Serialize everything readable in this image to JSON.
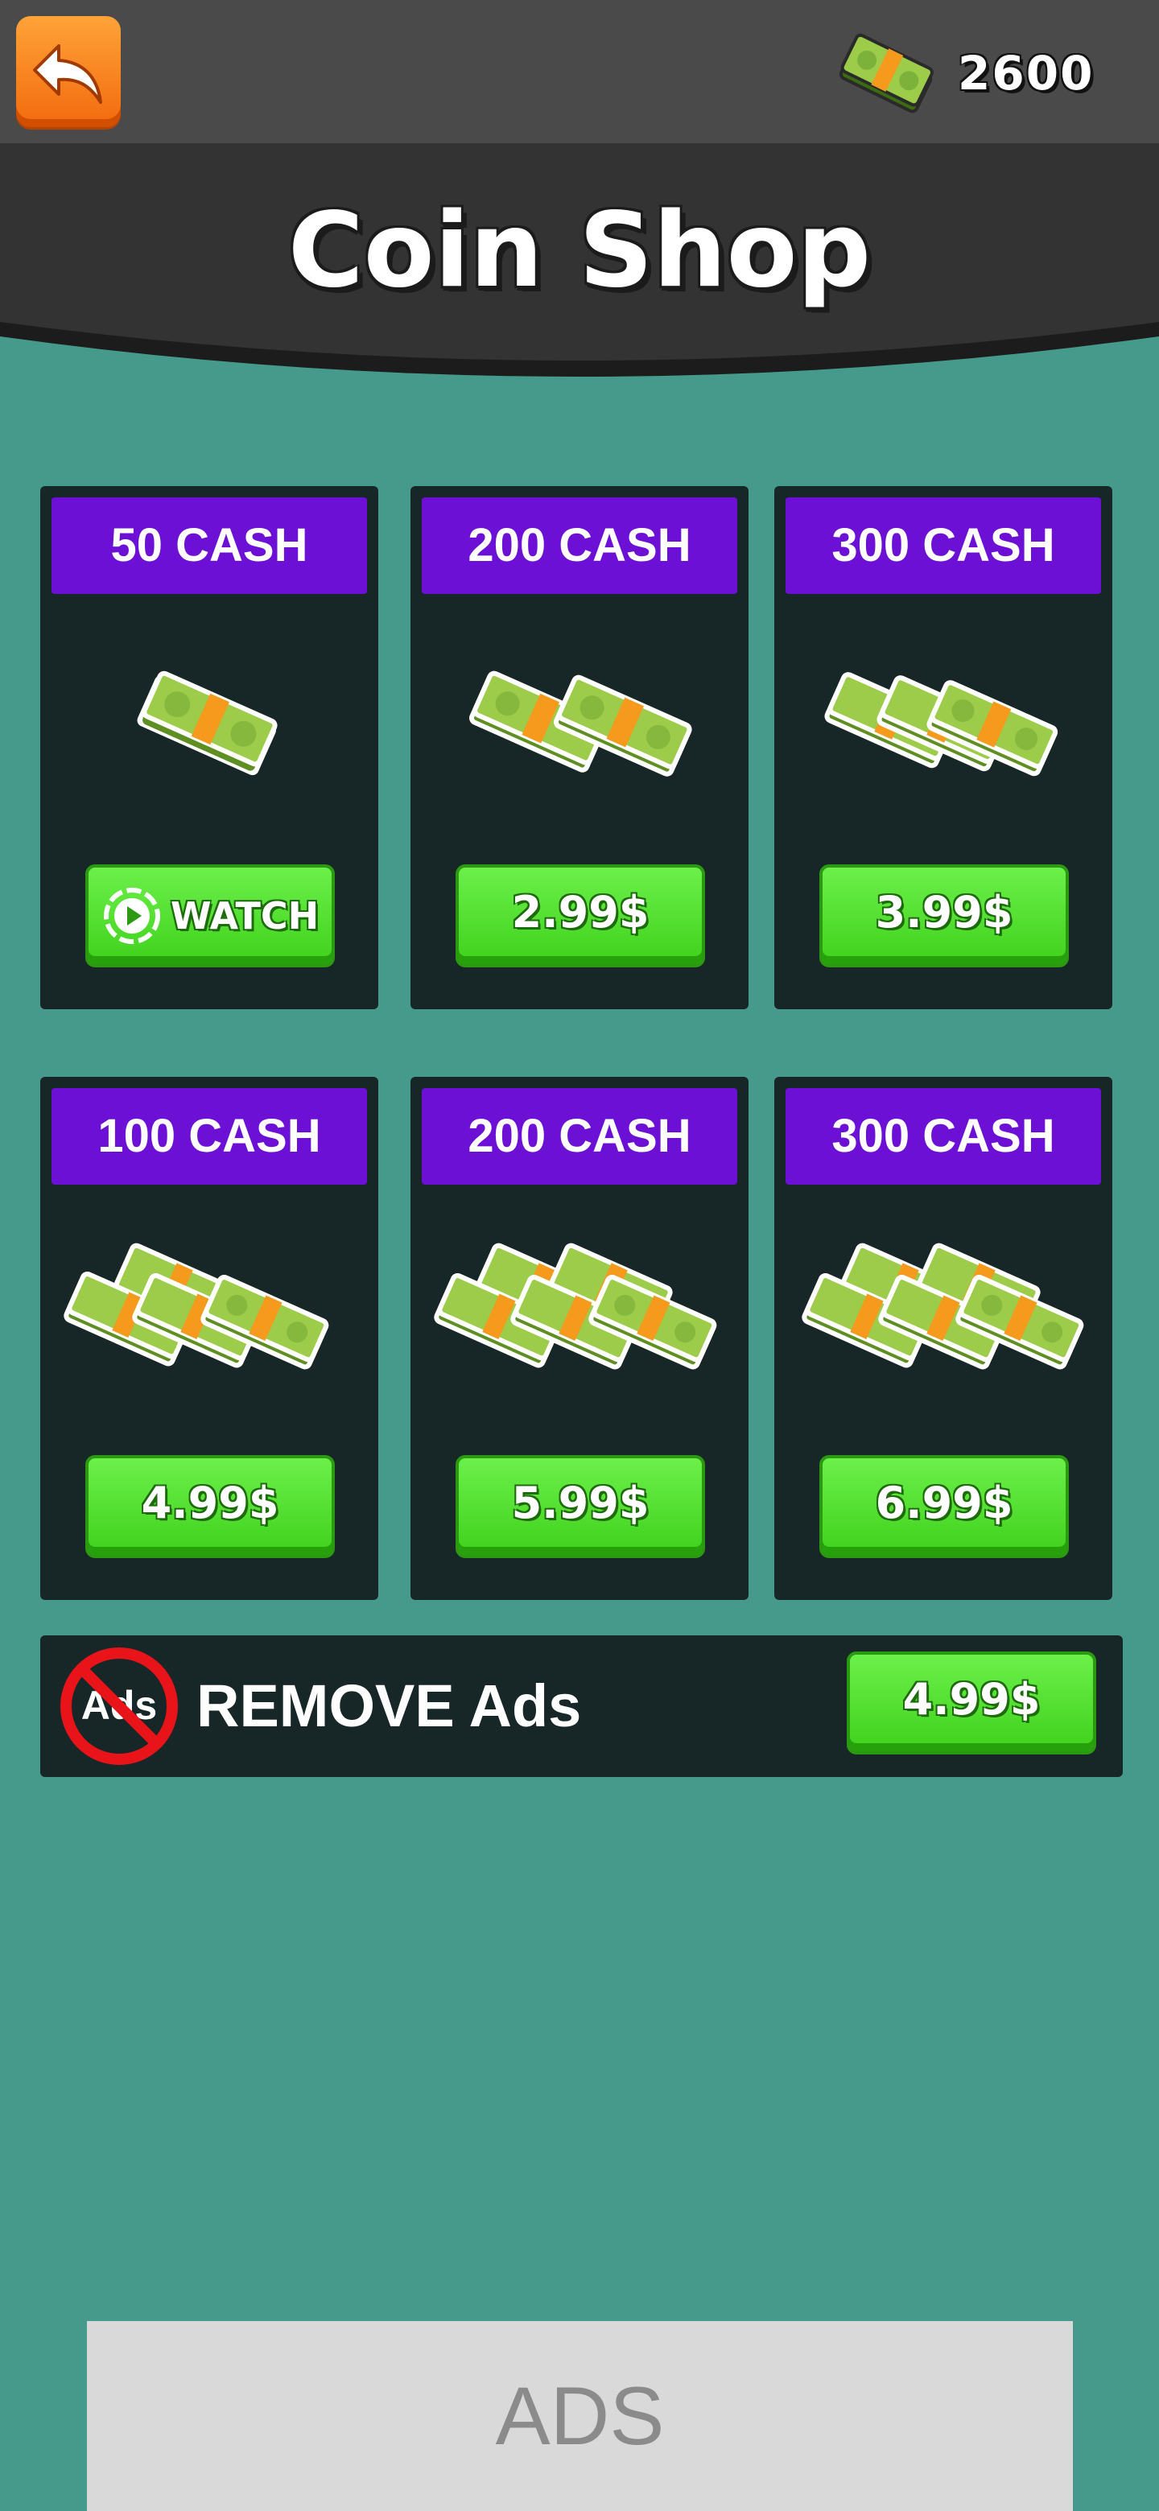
{
  "topbar": {
    "back_icon": "back-arrow-icon",
    "balance_icon": "cash-stack-icon",
    "balance": "2600"
  },
  "header": {
    "title": "Coin Shop"
  },
  "products_row1": [
    {
      "label": "50 CASH",
      "button": "WATCH",
      "button_icon": "play-circle-icon",
      "stacks": 1
    },
    {
      "label": "200 CASH",
      "button": "2.99$",
      "stacks": 2
    },
    {
      "label": "300 CASH",
      "button": "3.99$",
      "stacks": 3
    }
  ],
  "products_row2": [
    {
      "label": "100 CASH",
      "button": "4.99$",
      "stacks": 5
    },
    {
      "label": "200 CASH",
      "button": "5.99$",
      "stacks": 6
    },
    {
      "label": "300 CASH",
      "button": "6.99$",
      "stacks": 6
    }
  ],
  "remove_ads": {
    "icon": "no-ads-icon",
    "icon_text": "Ads",
    "label": "REMOVE Ads",
    "button": "4.99$"
  },
  "ad_banner": {
    "text": "ADS"
  },
  "colors": {
    "background": "#459a8c",
    "topbar": "#4a4a4a",
    "header": "#333333",
    "card": "#172626",
    "label_purple": "#6d10d6",
    "button_green": "#3fd11c",
    "back_orange": "#f58a1f"
  }
}
